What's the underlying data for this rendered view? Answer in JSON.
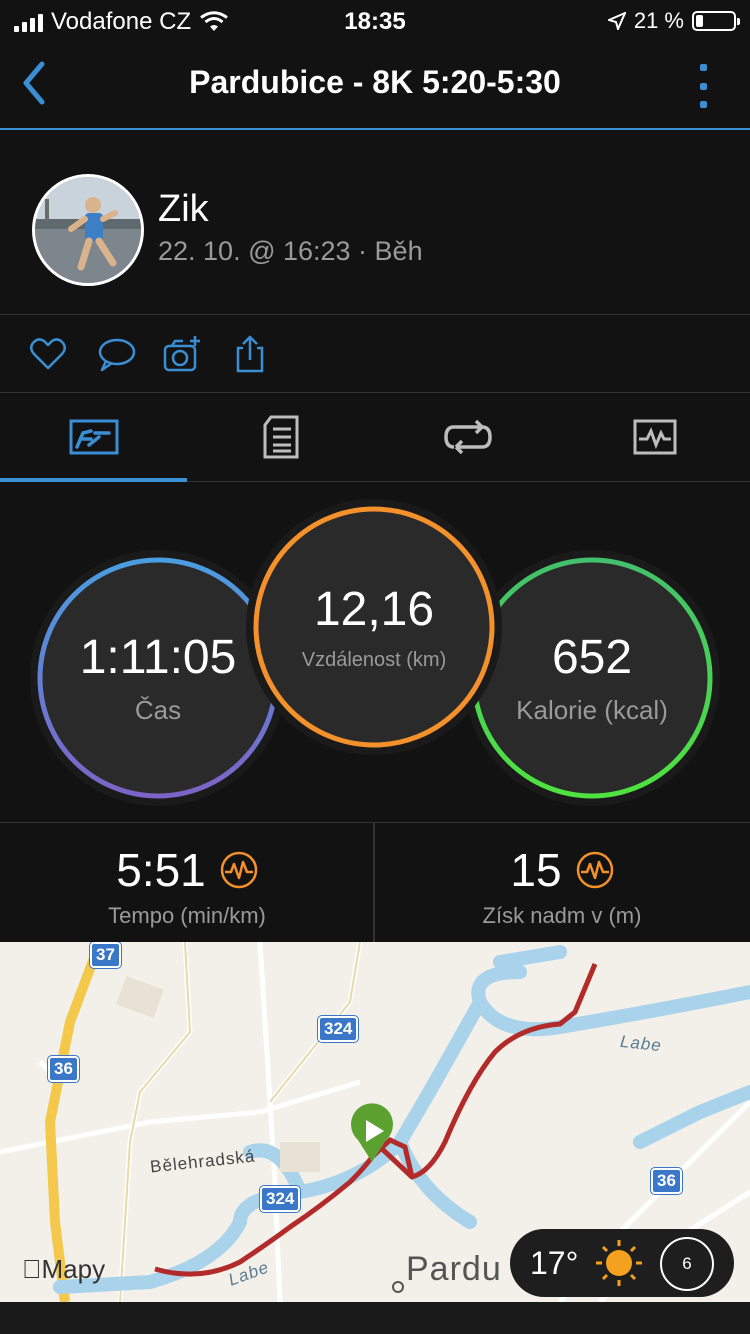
{
  "status": {
    "carrier": "Vodafone CZ",
    "time": "18:35",
    "battery": "21 %"
  },
  "nav": {
    "title": "Pardubice - 8K 5:20-5:30"
  },
  "profile": {
    "name": "Zik",
    "meta": "22. 10. @ 16:23 · Běh"
  },
  "icons": [
    "heart-icon",
    "comment-icon",
    "camera-add-icon",
    "share-icon"
  ],
  "tabs": [
    "summary-tab-icon",
    "details-tab-icon",
    "laps-tab-icon",
    "chart-tab-icon"
  ],
  "colors": {
    "accent": "#3a8fd4",
    "time_ring": "#5a7fe0",
    "distance_ring": "#f4912b",
    "calories_ring": "#4cc94c",
    "route": "#b22a2a",
    "start_marker": "#5ba12f"
  },
  "metrics": {
    "time": {
      "value": "1:11:05",
      "label": "Čas"
    },
    "distance": {
      "value": "12,16",
      "label": "Vzdálenost (km)"
    },
    "calories": {
      "value": "652",
      "label": "Kalorie (kcal)"
    }
  },
  "stats": {
    "pace": {
      "value": "5:51",
      "label": "Tempo (min/km)"
    },
    "elevation": {
      "value": "15",
      "label": "Získ nadm v (m)"
    }
  },
  "map": {
    "badges": [
      "37",
      "36",
      "324",
      "324",
      "36"
    ],
    "labels": {
      "river1": "Labe",
      "river2": "Labe",
      "street": "Bělehradská",
      "city": "Pardu"
    },
    "attribution": "Mapy",
    "weather": {
      "temp": "17°",
      "uv": "6"
    }
  }
}
